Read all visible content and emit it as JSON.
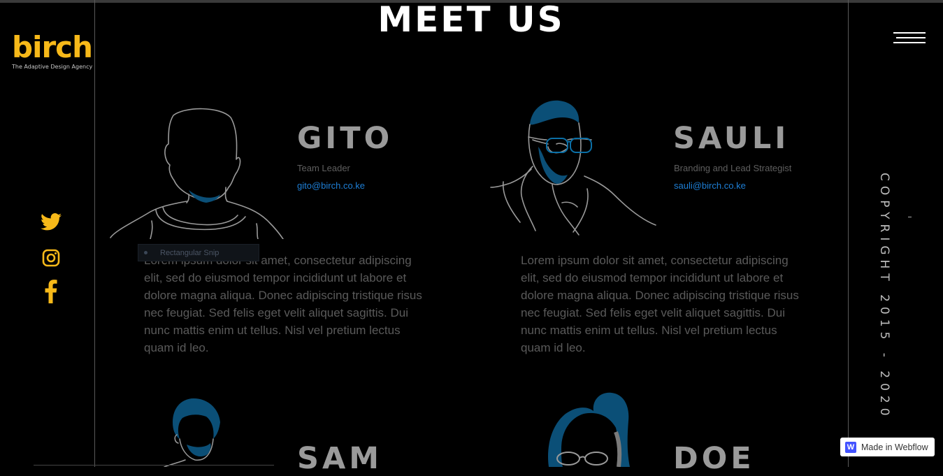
{
  "brand": {
    "name": "birch",
    "tagline": "The Adaptive Design Agency",
    "accent_color": "#f7b919"
  },
  "page": {
    "heading": "MEET US",
    "copyright": "COPYRIGHT 2015 - 2020",
    "badge_label": "Made in Webflow"
  },
  "social": [
    {
      "name": "twitter-icon"
    },
    {
      "name": "instagram-icon"
    },
    {
      "name": "facebook-icon"
    }
  ],
  "tooltip": {
    "label": "Rectangular Snip"
  },
  "team": [
    {
      "name": "GITO",
      "role": "Team Leader",
      "email": "gito@birch.co.ke",
      "bio": "Lorem ipsum dolor sit amet, consectetur adipiscing elit, sed do eiusmod tempor incididunt ut labore et dolore magna aliqua. Donec adipiscing tristique risus nec feugiat. Sed felis eget velit aliquet sagittis. Dui nunc mattis enim ut tellus. Nisl vel pretium lectus quam id leo."
    },
    {
      "name": "SAULI",
      "role": "Branding and Lead Strategist",
      "email": "sauli@birch.co.ke",
      "bio": "Lorem ipsum dolor sit amet, consectetur adipiscing elit, sed do eiusmod tempor incididunt ut labore et dolore magna aliqua. Donec adipiscing tristique risus nec feugiat. Sed felis eget velit aliquet sagittis. Dui nunc mattis enim ut tellus. Nisl vel pretium lectus quam id leo."
    },
    {
      "name": "SAM"
    },
    {
      "name": "DOE"
    }
  ],
  "colors": {
    "background": "#000000",
    "name_gray": "#9a9a9a",
    "email_blue": "#1e7fd6",
    "portrait_blue": "#0b4f77"
  }
}
